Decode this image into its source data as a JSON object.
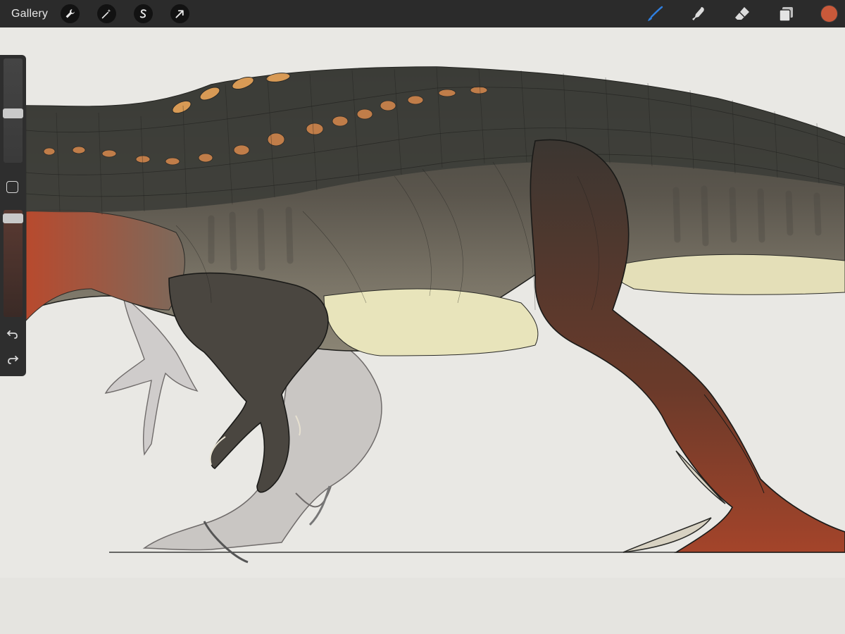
{
  "topbar": {
    "gallery_label": "Gallery",
    "left_tools": [
      {
        "name": "actions",
        "icon": "wrench-icon"
      },
      {
        "name": "adjustments",
        "icon": "magic-wand-icon"
      },
      {
        "name": "selection",
        "icon": "selection-s-icon"
      },
      {
        "name": "transform",
        "icon": "arrow-cursor-icon"
      }
    ],
    "right_tools": [
      {
        "name": "brush",
        "icon": "brush-icon",
        "active": true,
        "active_color": "#2f7fe0"
      },
      {
        "name": "smudge",
        "icon": "smudge-finger-icon"
      },
      {
        "name": "eraser",
        "icon": "eraser-icon"
      },
      {
        "name": "layers",
        "icon": "layers-icon"
      }
    ],
    "current_color": "#c9593a"
  },
  "sidebar": {
    "brush_size": 0.55,
    "opacity": 1.0,
    "modify_icon": "square-icon",
    "undo_icon": "undo-arrow-icon",
    "redo_icon": "redo-arrow-icon"
  },
  "canvas": {
    "artwork": "dinosaur-sketch",
    "background_color": "#e9e8e4"
  }
}
